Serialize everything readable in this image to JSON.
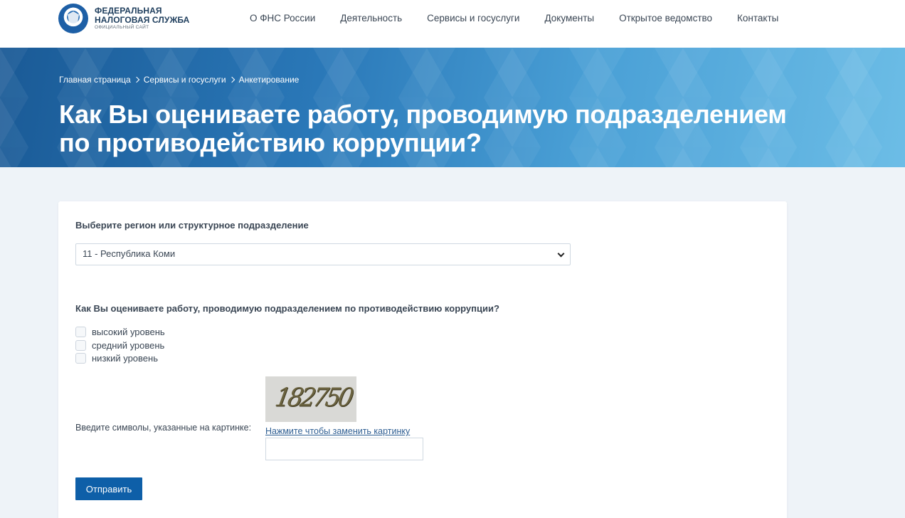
{
  "header": {
    "logo": {
      "line1": "ФЕДЕРАЛЬНАЯ",
      "line2": "НАЛОГОВАЯ СЛУЖБА",
      "sub": "ОФИЦИАЛЬНЫЙ САЙТ"
    },
    "nav": [
      {
        "label": "О ФНС России"
      },
      {
        "label": "Деятельность"
      },
      {
        "label": "Сервисы и госуслуги"
      },
      {
        "label": "Документы"
      },
      {
        "label": "Открытое ведомство"
      },
      {
        "label": "Контакты"
      }
    ]
  },
  "breadcrumb": [
    "Главная страница",
    "Сервисы и госуслуги",
    "Анкетирование"
  ],
  "page_title": "Как Вы оцениваете работу, проводимую подразделением по противодействию коррупции?",
  "form": {
    "region_label": "Выберите регион или структурное подразделение",
    "region_value": "11 - Республика Коми",
    "question": "Как Вы оцениваете работу, проводимую подразделением по противодействию коррупции?",
    "options": [
      {
        "label": "высокий уровень",
        "checked": false
      },
      {
        "label": "средний уровень",
        "checked": false
      },
      {
        "label": "низкий уровень",
        "checked": false
      }
    ],
    "captcha_label": "Введите символы, указанные на картинке:",
    "captcha_code": "182750",
    "captcha_refresh": "Нажмите чтобы заменить картинку",
    "captcha_value": "",
    "submit_label": "Отправить"
  },
  "colors": {
    "accent": "#0e5fa8",
    "hero_start": "#1a5a96",
    "hero_end": "#6cbde6",
    "page_bg": "#eef3f8"
  }
}
